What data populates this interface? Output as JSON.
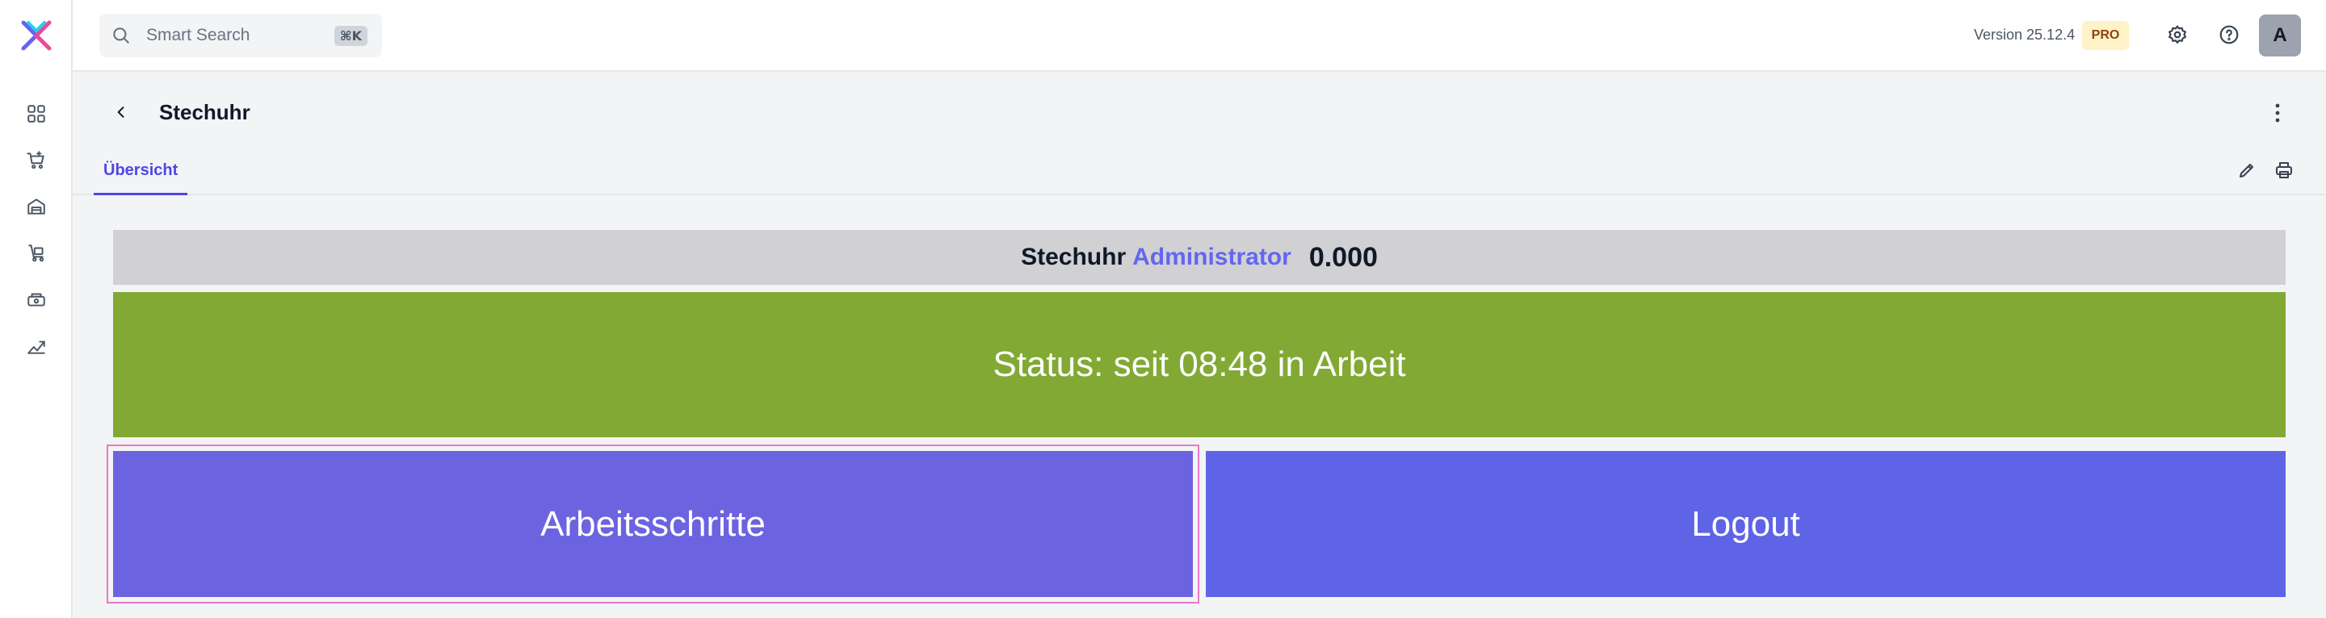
{
  "search": {
    "placeholder": "Smart Search",
    "shortcut": "⌘K"
  },
  "header": {
    "version": "Version 25.12.4",
    "badge": "PRO",
    "avatar_initial": "A"
  },
  "page": {
    "title": "Stechuhr"
  },
  "tabs": [
    {
      "label": "Übersicht",
      "active": true
    }
  ],
  "clock": {
    "label": "Stechuhr",
    "user": "Administrator",
    "value": "0.000"
  },
  "status": {
    "text": "Status: seit 08:48 in Arbeit",
    "color": "#82a934"
  },
  "buttons": {
    "steps": "Arbeitsschritte",
    "logout": "Logout"
  },
  "sidebar": {
    "icons": [
      "dashboard-icon",
      "cart-icon",
      "warehouse-icon",
      "trolley-icon",
      "register-icon",
      "chart-icon"
    ]
  },
  "colors": {
    "accent": "#4f46e5",
    "steps_button": "#6c63e0",
    "logout_button": "#5f64e6"
  }
}
